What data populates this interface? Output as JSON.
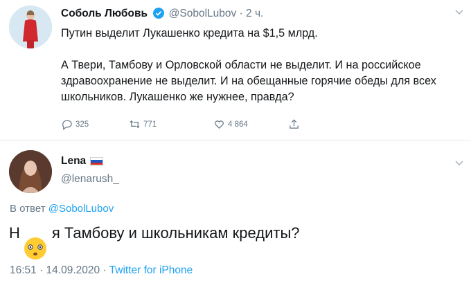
{
  "tweet": {
    "author_name": "Соболь Любовь",
    "handle_time": "@SobolLubov · 2 ч.",
    "text": "Путин выделит Лукашенко кредита на $1,5 млрд.\n\nА Твери, Тамбову и Орловской области не выделит. И на российское здравоохранение не выделит. И на обещанные горячие обеды для всех школьников. Лукашенко же нужнее, правда?",
    "replies": "325",
    "retweets": "771",
    "likes": "4 864"
  },
  "reply_tweet": {
    "author_name": "Lena",
    "handle": "@lenarush_",
    "reply_to_prefix": "В ответ ",
    "reply_to_handle": "@SobolLubov",
    "text_start": "Н",
    "text_end": "я Тамбову и школьникам кредиты?",
    "timestamp": "16:51 · 14.09.2020 · ",
    "source": "Twitter for iPhone"
  },
  "colors": {
    "accent": "#1da1f2",
    "muted": "#657786",
    "text": "#14171a"
  },
  "icons": [
    "verified-icon",
    "chevron-down-icon",
    "reply-icon",
    "retweet-icon",
    "like-icon",
    "share-icon",
    "russia-flag-icon",
    "face-emoji-icon"
  ]
}
